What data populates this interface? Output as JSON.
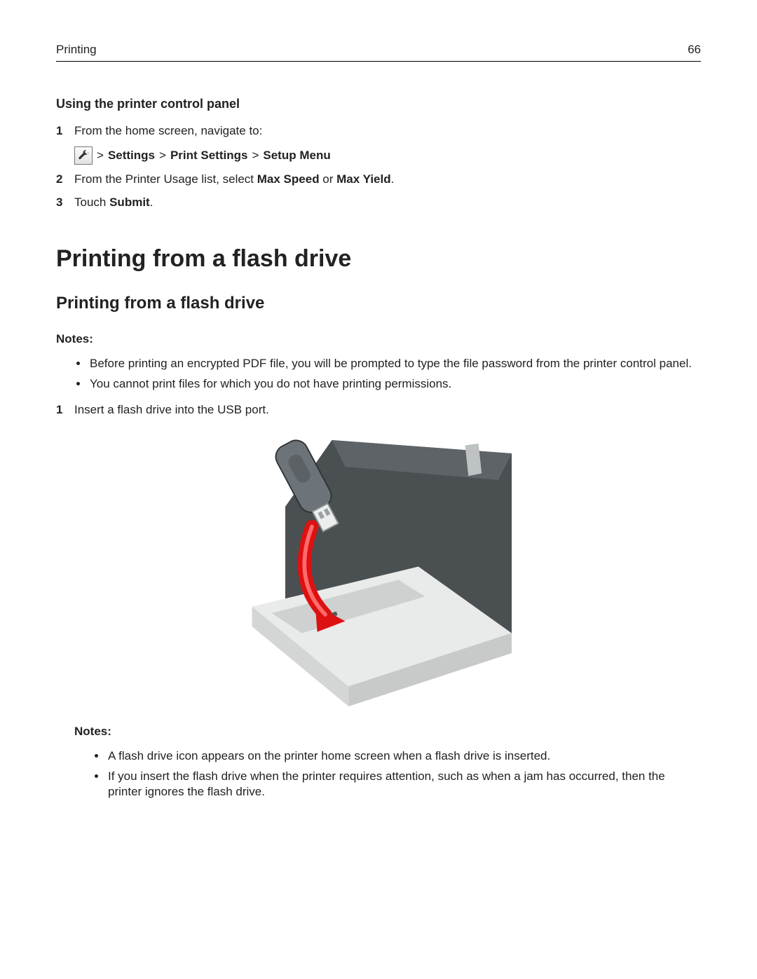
{
  "header": {
    "section": "Printing",
    "page": "66"
  },
  "sec1": {
    "title": "Using the printer control panel",
    "step1": {
      "n": "1",
      "text": "From the home screen, navigate to:"
    },
    "path": {
      "gt1": ">",
      "p1": "Settings",
      "gt2": ">",
      "p2": "Print Settings",
      "gt3": ">",
      "p3": "Setup Menu"
    },
    "step2": {
      "n": "2",
      "t1": "From the Printer Usage list, select ",
      "b1": "Max Speed",
      "t2": " or ",
      "b2": "Max Yield",
      "t3": "."
    },
    "step3": {
      "n": "3",
      "t1": "Touch ",
      "b1": "Submit",
      "t2": "."
    }
  },
  "h1": "Printing from a flash drive",
  "h2": "Printing from a flash drive",
  "notes1": {
    "label": "Notes:",
    "b1": "Before printing an encrypted PDF file, you will be prompted to type the file password from the printer control panel.",
    "b2": "You cannot print files for which you do not have printing permissions."
  },
  "step_flash": {
    "n": "1",
    "text": "Insert a flash drive into the USB port."
  },
  "notes2": {
    "label": "Notes:",
    "b1": "A flash drive icon appears on the printer home screen when a flash drive is inserted.",
    "b2": "If you insert the flash drive when the printer requires attention, such as when a jam has occurred, then the printer ignores the flash drive."
  }
}
